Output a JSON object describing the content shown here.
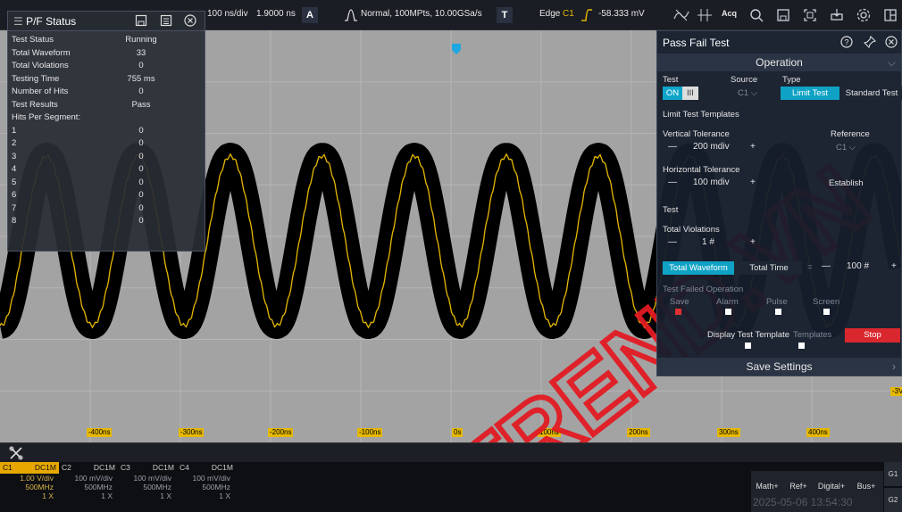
{
  "topbar": {
    "timebase": "100 ns/div",
    "delay": "1.9000 ns",
    "acq_badge": "A",
    "acq_text": "Normal, 100MPts, 10.00GSa/s",
    "trig_badge": "T",
    "trig_type": "Edge",
    "trig_source": "C1",
    "trig_level": "-58.333 mV",
    "acq_icon_label": "Acq"
  },
  "pf_status": {
    "title": "P/F Status",
    "rows": [
      {
        "k": "Test Status",
        "v": "Running"
      },
      {
        "k": "Total Waveform",
        "v": "33"
      },
      {
        "k": "Total Violations",
        "v": "0"
      },
      {
        "k": "Testing Time",
        "v": "755 ms"
      },
      {
        "k": "Number of Hits",
        "v": "0"
      },
      {
        "k": "Test Results",
        "v": "Pass"
      },
      {
        "k": "Hits Per Segment:",
        "v": ""
      },
      {
        "k": "1",
        "v": "0"
      },
      {
        "k": "2",
        "v": "0"
      },
      {
        "k": "3",
        "v": "0"
      },
      {
        "k": "4",
        "v": "0"
      },
      {
        "k": "5",
        "v": "0"
      },
      {
        "k": "6",
        "v": "0"
      },
      {
        "k": "7",
        "v": "0"
      },
      {
        "k": "8",
        "v": "0"
      }
    ]
  },
  "pft": {
    "title": "Pass Fail Test",
    "operation": "Operation",
    "test_label": "Test",
    "toggle_on": "ON",
    "toggle_off": "III",
    "source_label": "Source",
    "source_value": "C1",
    "type_label": "Type",
    "type_limit": "Limit Test",
    "type_standard": "Standard Test",
    "limit_templates": "Limit Test Templates",
    "vertical_tolerance": "Vertical Tolerance",
    "vertical_value": "200 mdiv",
    "reference_label": "Reference",
    "reference_value": "C1",
    "horizontal_tolerance": "Horizontal Tolerance",
    "horizontal_value": "100 mdiv",
    "establish": "Establish",
    "test_section": "Test",
    "total_violations": "Total Violations",
    "violations_value": "1 #",
    "total_waveform": "Total Waveform",
    "total_time": "Total Time",
    "equals": "=",
    "waveform_value": "100 #",
    "failed_op": "Test Failed Operation",
    "fail_save": "Save",
    "fail_alarm": "Alarm",
    "fail_pulse": "Pulse",
    "fail_screen": "Screen",
    "display_template": "Display Test Template",
    "templates": "Templates",
    "stop": "Stop",
    "save_settings": "Save Settings",
    "minus": "—",
    "plus": "+"
  },
  "timeaxis": [
    "-400ns",
    "-300ns",
    "-200ns",
    "-100ns",
    "0s",
    "100ns",
    "200ns",
    "300ns",
    "400ns"
  ],
  "right_marker": "-3V",
  "channels": [
    {
      "name": "C1",
      "coupling": "DC1M",
      "scale": "1.00 V/div",
      "bw": "500MHz",
      "probe": "1 X"
    },
    {
      "name": "C2",
      "coupling": "DC1M",
      "scale": "100 mV/div",
      "bw": "500MHz",
      "probe": "1 X"
    },
    {
      "name": "C3",
      "coupling": "DC1M",
      "scale": "100 mV/div",
      "bw": "500MHz",
      "probe": "1 X"
    },
    {
      "name": "C4",
      "coupling": "DC1M",
      "scale": "100 mV/div",
      "bw": "500MHz",
      "probe": "1 X"
    }
  ],
  "bottom_buttons": [
    "Math+",
    "Ref+",
    "Digital+",
    "Bus+"
  ],
  "g_buttons": [
    "G1",
    "G2"
  ],
  "datetime": "2025-05-06 13:54:30",
  "watermark": "TREND.VN",
  "colors": {
    "trace": "#e6b800",
    "accent": "#0fa2c4",
    "stop": "#d8282e",
    "channel_active": "#e6a800",
    "watermark": "#e31b23"
  }
}
